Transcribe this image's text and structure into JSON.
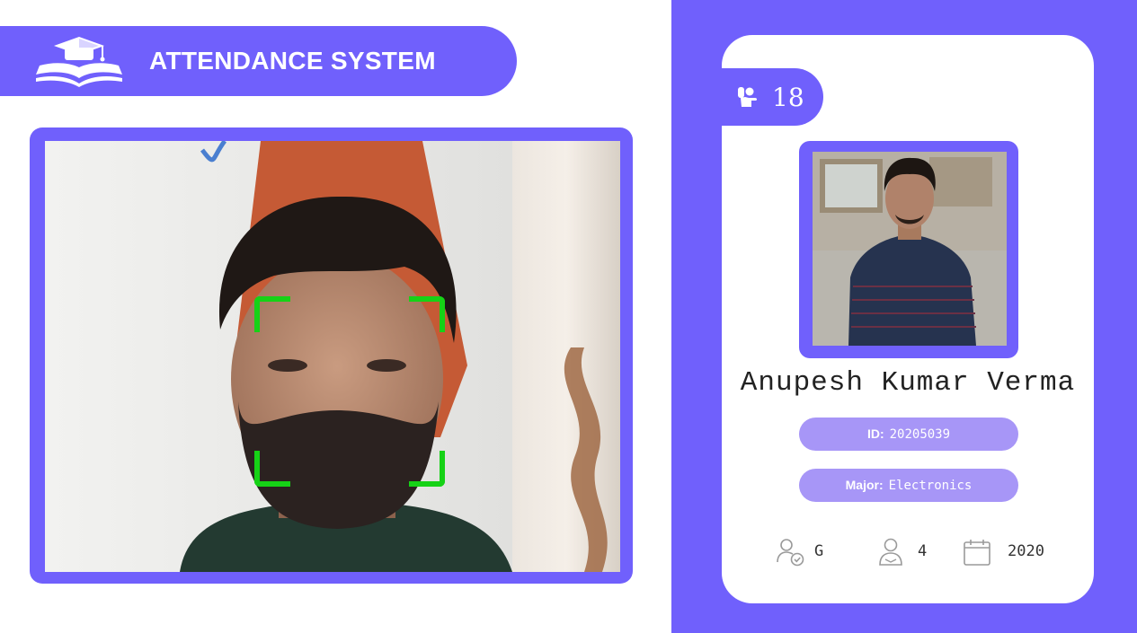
{
  "header": {
    "title": "ATTENDANCE SYSTEM",
    "logo_icon": "graduation-cap-book-icon"
  },
  "colors": {
    "accent": "#7060fc",
    "pill": "#a796f7",
    "face_box": "#16d216"
  },
  "camera": {
    "detection_box_color": "#16d216"
  },
  "student": {
    "attendance_count": "18",
    "attendance_icon": "raised-hand-icon",
    "name": "Anupesh Kumar Verma",
    "id_label": "ID:",
    "id_value": "20205039",
    "major_label": "Major:",
    "major_value": "Electronics",
    "standing": "G",
    "standing_icon": "user-check-icon",
    "year": "4",
    "year_icon": "student-icon",
    "starting_year": "2020",
    "starting_year_icon": "calendar-icon"
  }
}
